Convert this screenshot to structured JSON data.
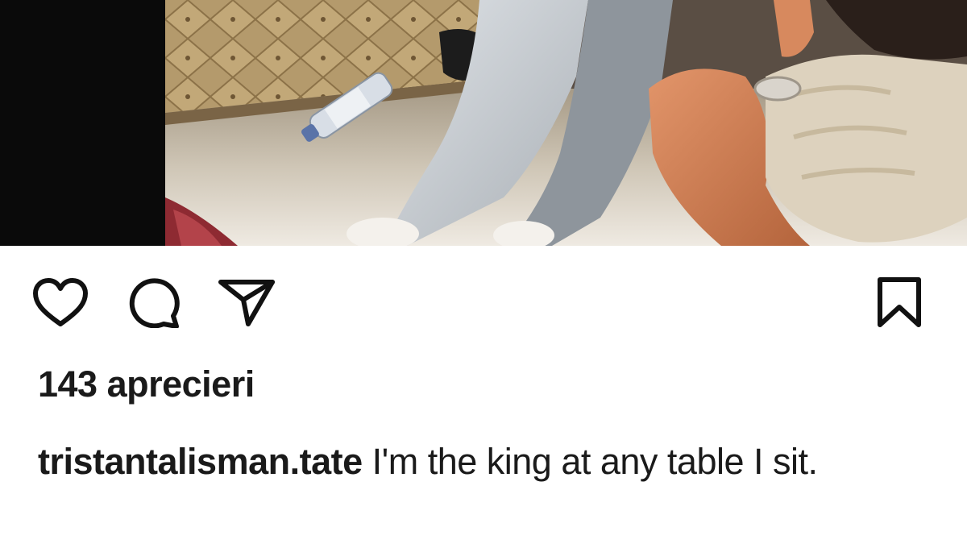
{
  "post": {
    "likes_text": "143 aprecieri",
    "caption_username": "tristantalisman.tate",
    "caption_text": " I'm the king at any table I sit."
  },
  "actions": {
    "like_icon": "heart-icon",
    "comment_icon": "speech-bubble-icon",
    "share_icon": "paper-plane-icon",
    "save_icon": "bookmark-icon"
  },
  "colors": {
    "text": "#1a1a1a",
    "background": "#ffffff"
  }
}
